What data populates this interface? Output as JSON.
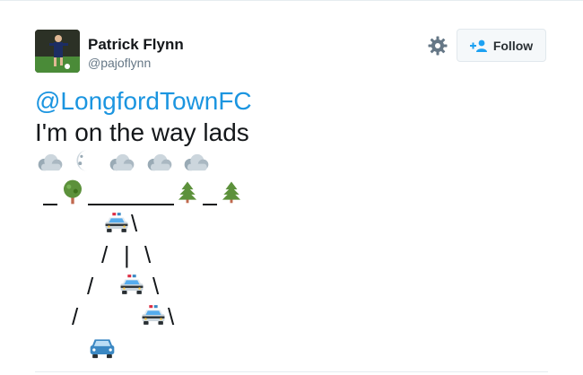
{
  "user": {
    "display_name": "Patrick Flynn",
    "handle": "@pajoflynn"
  },
  "actions": {
    "follow_label": "Follow"
  },
  "tweet": {
    "mention": "@LongfordTownFC",
    "line1": "I'm on the way lads",
    "road_slash": "/",
    "road_backslash": "\\",
    "road_pipe": "|"
  },
  "icons": {
    "gear": "gear-icon",
    "add_user": "add-user-icon",
    "cloud": "cloud-icon",
    "moon": "crescent-moon-icon",
    "tree": "deciduous-tree-icon",
    "pine": "evergreen-tree-icon",
    "police_car": "police-car-icon",
    "car": "car-icon"
  },
  "colors": {
    "link": "#1b95e0",
    "handle": "#657786",
    "text": "#14171a"
  }
}
